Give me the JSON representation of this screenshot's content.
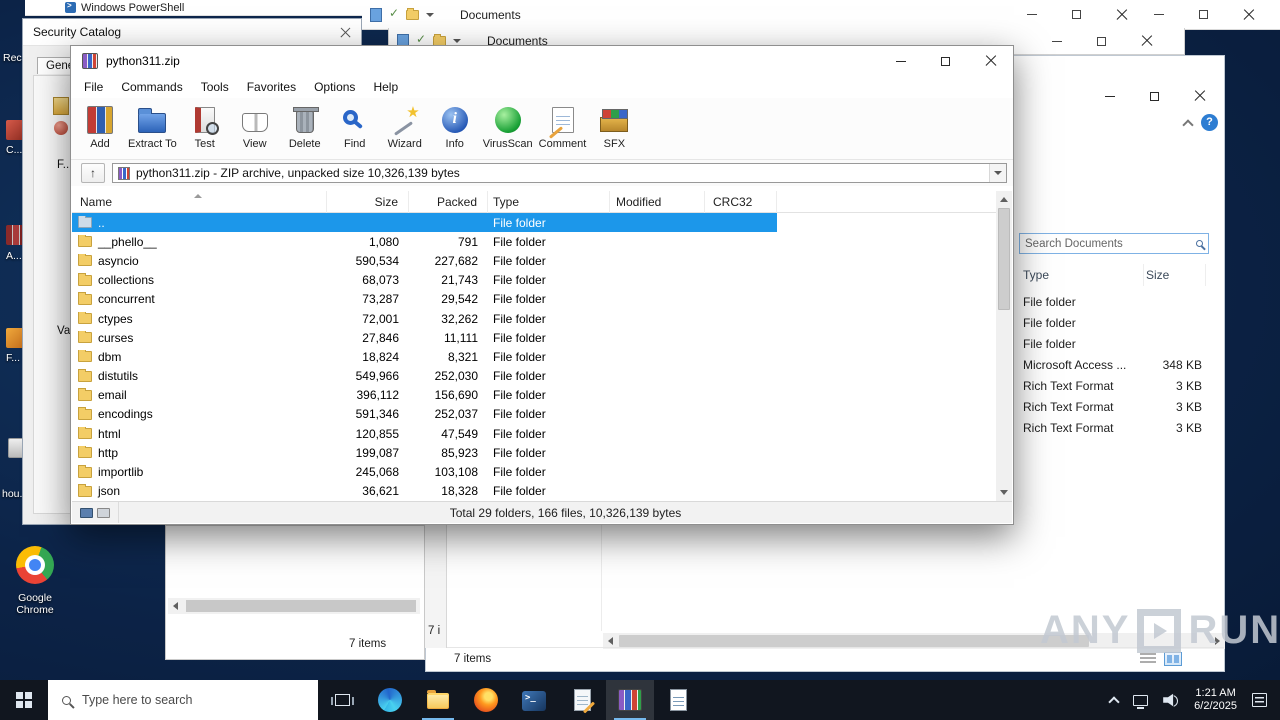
{
  "colors": {
    "selection_blue": "#1c97ea",
    "desktop_blue": "#0c2347",
    "taskbar_dark": "#11161f"
  },
  "desktop": {
    "icons": [
      {
        "label": "Rec..."
      },
      {
        "label": "C..."
      },
      {
        "label": "A..."
      },
      {
        "label": "F..."
      },
      {
        "label": "hou..."
      },
      {
        "label": "Google Chrome"
      }
    ],
    "watermark": {
      "left": "ANY",
      "right": "RUN"
    }
  },
  "background": {
    "powershell_title": "Windows PowerShell",
    "security_catalog": {
      "title": "Security Catalog",
      "tab": "Genera...",
      "label_f": "F...",
      "label_va": "Va..."
    },
    "explorer1": {
      "title": "Documents"
    },
    "explorer2": {
      "title": "Documents"
    },
    "right_panel": {
      "search_placeholder": "Search Documents",
      "columns": [
        "Type",
        "Size"
      ],
      "rows": [
        {
          "type": "File folder",
          "size": ""
        },
        {
          "type": "File folder",
          "size": ""
        },
        {
          "type": "File folder",
          "size": ""
        },
        {
          "type": "Microsoft Access ...",
          "size": "348 KB"
        },
        {
          "type": "Rich Text Format",
          "size": "3 KB"
        },
        {
          "type": "Rich Text Format",
          "size": "3 KB"
        },
        {
          "type": "Rich Text Format",
          "size": "3 KB"
        }
      ],
      "status": "7 items"
    },
    "pane_status_left": "7 items",
    "pane_status_strip": "7 i",
    "pane_status_main": "7 items"
  },
  "winrar": {
    "title": "python311.zip",
    "menu": [
      "File",
      "Commands",
      "Tools",
      "Favorites",
      "Options",
      "Help"
    ],
    "toolbar": [
      "Add",
      "Extract To",
      "Test",
      "View",
      "Delete",
      "Find",
      "Wizard",
      "Info",
      "VirusScan",
      "Comment",
      "SFX"
    ],
    "address": "python311.zip - ZIP archive, unpacked size 10,326,139 bytes",
    "columns": [
      "Name",
      "Size",
      "Packed",
      "Type",
      "Modified",
      "CRC32"
    ],
    "rows": [
      {
        "name": "..",
        "size": "",
        "packed": "",
        "type": "File folder",
        "selected": true
      },
      {
        "name": "__phello__",
        "size": "1,080",
        "packed": "791",
        "type": "File folder"
      },
      {
        "name": "asyncio",
        "size": "590,534",
        "packed": "227,682",
        "type": "File folder"
      },
      {
        "name": "collections",
        "size": "68,073",
        "packed": "21,743",
        "type": "File folder"
      },
      {
        "name": "concurrent",
        "size": "73,287",
        "packed": "29,542",
        "type": "File folder"
      },
      {
        "name": "ctypes",
        "size": "72,001",
        "packed": "32,262",
        "type": "File folder"
      },
      {
        "name": "curses",
        "size": "27,846",
        "packed": "11,111",
        "type": "File folder"
      },
      {
        "name": "dbm",
        "size": "18,824",
        "packed": "8,321",
        "type": "File folder"
      },
      {
        "name": "distutils",
        "size": "549,966",
        "packed": "252,030",
        "type": "File folder"
      },
      {
        "name": "email",
        "size": "396,112",
        "packed": "156,690",
        "type": "File folder"
      },
      {
        "name": "encodings",
        "size": "591,346",
        "packed": "252,037",
        "type": "File folder"
      },
      {
        "name": "html",
        "size": "120,855",
        "packed": "47,549",
        "type": "File folder"
      },
      {
        "name": "http",
        "size": "199,087",
        "packed": "85,923",
        "type": "File folder"
      },
      {
        "name": "importlib",
        "size": "245,068",
        "packed": "103,108",
        "type": "File folder"
      },
      {
        "name": "json",
        "size": "36,621",
        "packed": "18,328",
        "type": "File folder"
      }
    ],
    "status": "Total 29 folders, 166 files, 10,326,139 bytes"
  },
  "taskbar": {
    "search_placeholder": "Type here to search",
    "clock": {
      "time": "1:21 AM",
      "date": "6/2/2025"
    }
  }
}
